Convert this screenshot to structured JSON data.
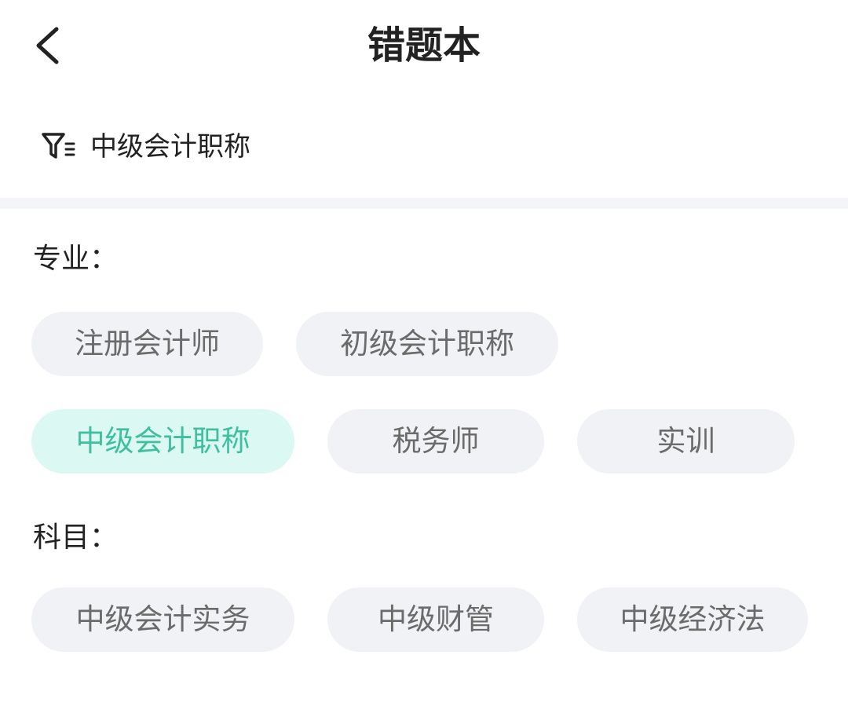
{
  "header": {
    "title": "错题本",
    "back_icon": "chevron-left-icon"
  },
  "filter": {
    "icon": "filter-icon",
    "current": "中级会计职称"
  },
  "major": {
    "label": "专业：",
    "chips": [
      {
        "label": "注册会计师",
        "selected": false
      },
      {
        "label": "初级会计职称",
        "selected": false
      },
      {
        "label": "中级会计职称",
        "selected": true
      },
      {
        "label": "税务师",
        "selected": false
      },
      {
        "label": "实训",
        "selected": false
      }
    ]
  },
  "subject": {
    "label": "科目：",
    "chips": [
      {
        "label": "中级会计实务",
        "selected": false
      },
      {
        "label": "中级财管",
        "selected": false
      },
      {
        "label": "中级经济法",
        "selected": false
      }
    ]
  },
  "colors": {
    "text_primary": "#222222",
    "chip_text": "#6b6b6b",
    "chip_bg": "#f1f2f5",
    "accent_text": "#3fbf9f",
    "accent_bg": "#dcf8f3",
    "divider": "#f3f5f8"
  }
}
